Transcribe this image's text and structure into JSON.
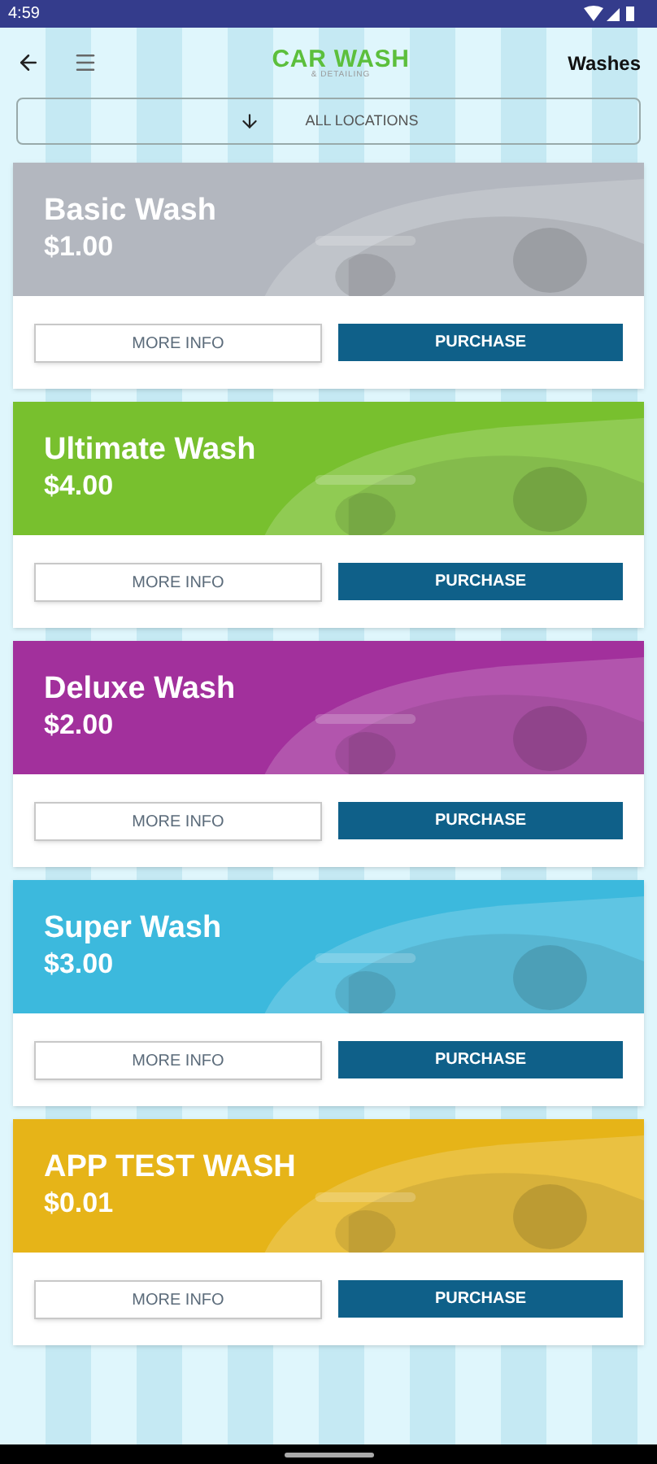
{
  "status_bar": {
    "time": "4:59"
  },
  "header": {
    "logo": {
      "title": "CAR WASH",
      "subtitle": "& DETAILING"
    },
    "title": "Washes"
  },
  "location_filter": {
    "label": "ALL LOCATIONS"
  },
  "washes": [
    {
      "name": "Basic Wash",
      "price": "$1.00",
      "color": "#b3b7bf",
      "buttons": [
        "MORE INFO",
        "PURCHASE"
      ]
    },
    {
      "name": "Ultimate Wash",
      "price": "$4.00",
      "color": "#78c02e",
      "buttons": [
        "MORE INFO",
        "PURCHASE"
      ]
    },
    {
      "name": "Deluxe Wash",
      "price": "$2.00",
      "color": "#a2309c",
      "buttons": [
        "MORE INFO",
        "PURCHASE"
      ]
    },
    {
      "name": "Super Wash",
      "price": "$3.00",
      "color": "#3cb9dd",
      "buttons": [
        "MORE INFO",
        "PURCHASE"
      ]
    },
    {
      "name": "APP TEST WASH",
      "price": "$0.01",
      "color": "#e6b418",
      "buttons": [
        "MORE INFO",
        "PURCHASE"
      ]
    }
  ]
}
